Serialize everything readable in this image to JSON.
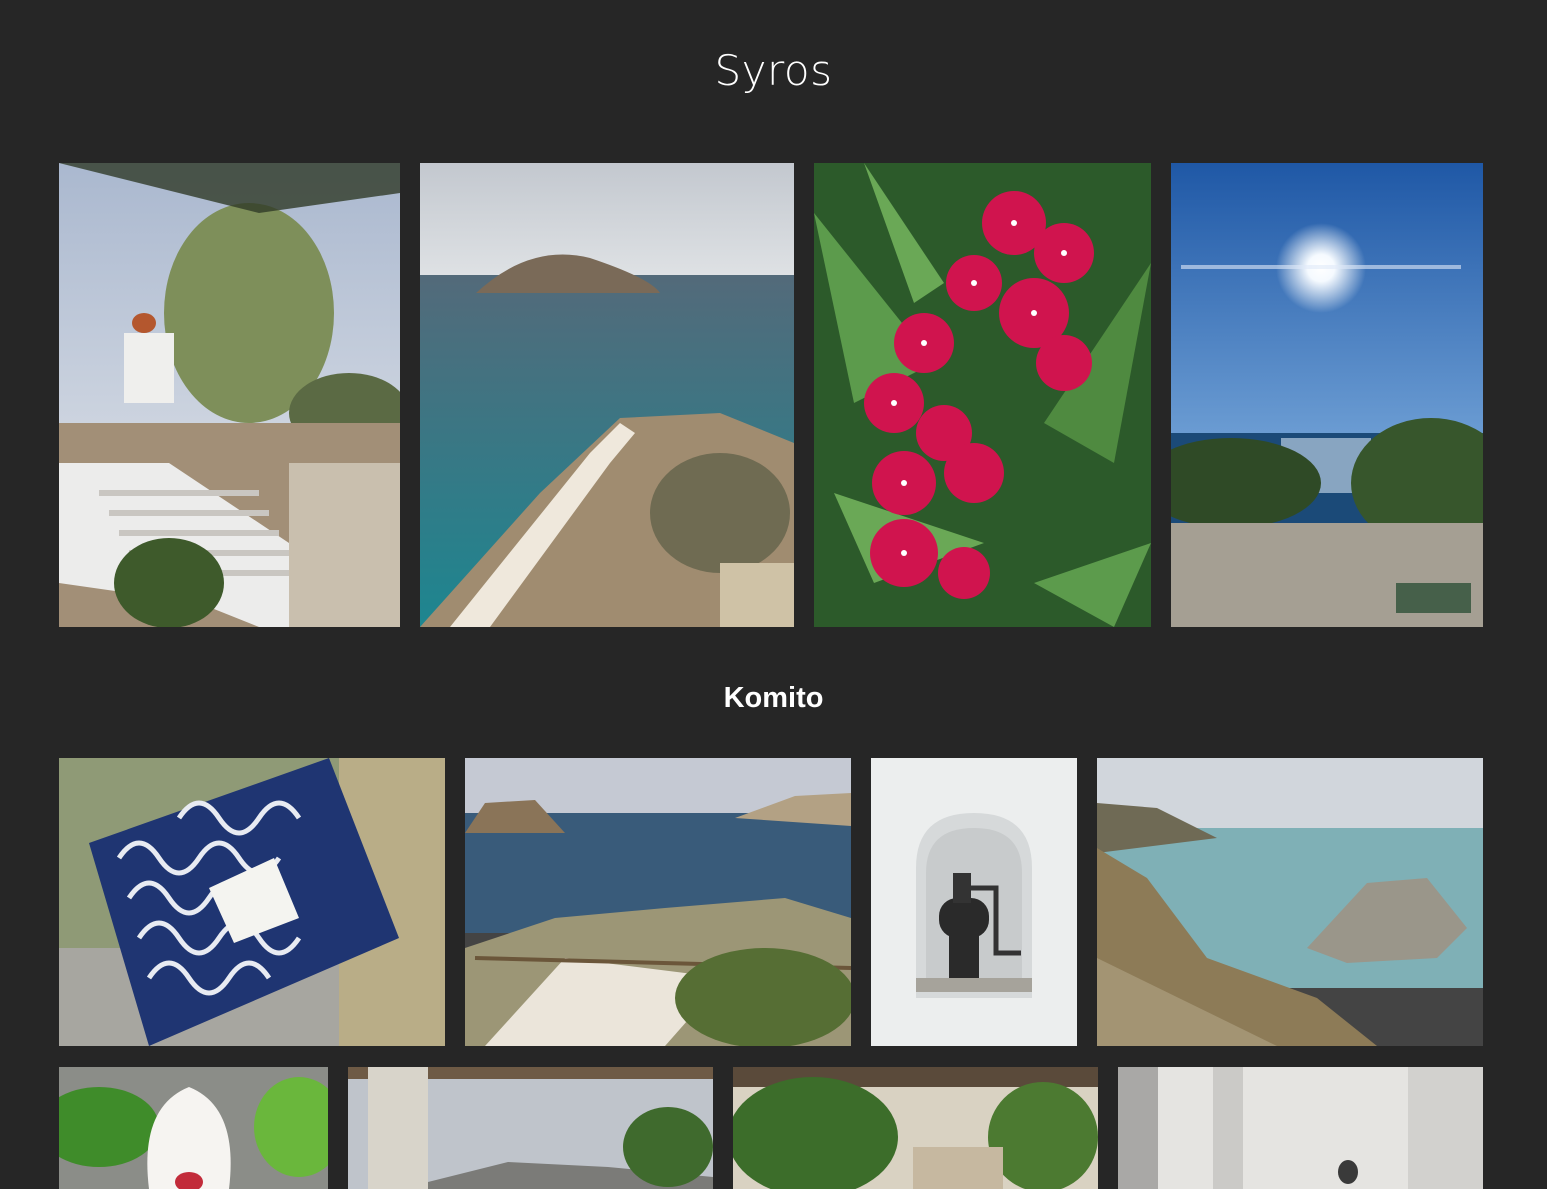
{
  "album": {
    "title": "Syros"
  },
  "sections": [
    {
      "title": "Komito"
    }
  ],
  "photos": {
    "syros_row": [
      {
        "icon": "photo-white-staircase"
      },
      {
        "icon": "photo-island-sea-stairs"
      },
      {
        "icon": "photo-red-oleander-flowers"
      },
      {
        "icon": "photo-sun-over-sea"
      }
    ],
    "komito_row1": [
      {
        "icon": "photo-blue-patterned-napkin"
      },
      {
        "icon": "photo-bay-with-island"
      },
      {
        "icon": "photo-coffee-grinder-niche"
      },
      {
        "icon": "photo-rocky-coast"
      }
    ],
    "komito_row2": [
      {
        "icon": "photo-white-hibiscus"
      },
      {
        "icon": "photo-pergola-view"
      },
      {
        "icon": "photo-courtyard-plants"
      },
      {
        "icon": "photo-white-wall-interior"
      }
    ]
  },
  "colors": {
    "background": "#262626",
    "text": "#ffffff"
  }
}
